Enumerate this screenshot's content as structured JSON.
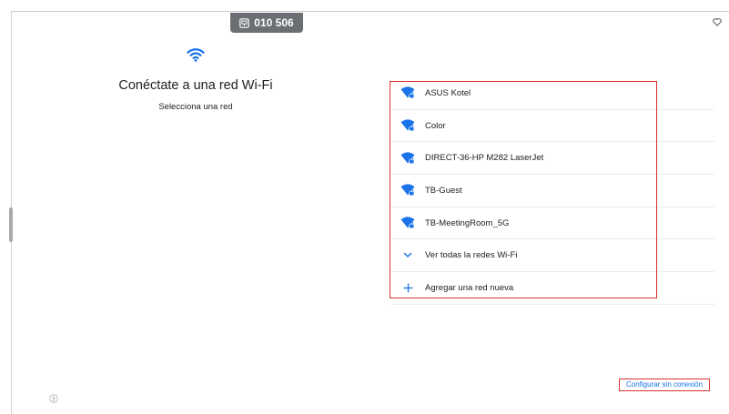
{
  "header": {
    "device_code": "010 506",
    "device_code_icon": "device-icon",
    "corner_icon": "heart-outline-icon"
  },
  "main": {
    "icon": "wifi-icon",
    "title": "Conéctate a una red Wi-Fi",
    "subtitle": "Selecciona una red"
  },
  "networks": [
    {
      "label": "ASUS Kotel",
      "icon": "wifi-locked-icon"
    },
    {
      "label": "Color",
      "icon": "wifi-locked-icon"
    },
    {
      "label": "DIRECT-36-HP M282 LaserJet",
      "icon": "wifi-locked-icon"
    },
    {
      "label": "TB-Guest",
      "icon": "wifi-locked-icon"
    },
    {
      "label": "TB-MeetingRoom_5G",
      "icon": "wifi-locked-icon"
    },
    {
      "label": "Ver todas la redes Wi-Fi",
      "icon": "chevron-down-icon"
    },
    {
      "label": "Agregar una red nueva",
      "icon": "plus-icon"
    }
  ],
  "footer": {
    "offline_link": "Configurar sin conexión",
    "accessibility_icon": "accessibility-icon"
  },
  "colors": {
    "accent": "#1a73e8",
    "highlight": "#d9302e",
    "badge_bg": "#6b6e72"
  }
}
